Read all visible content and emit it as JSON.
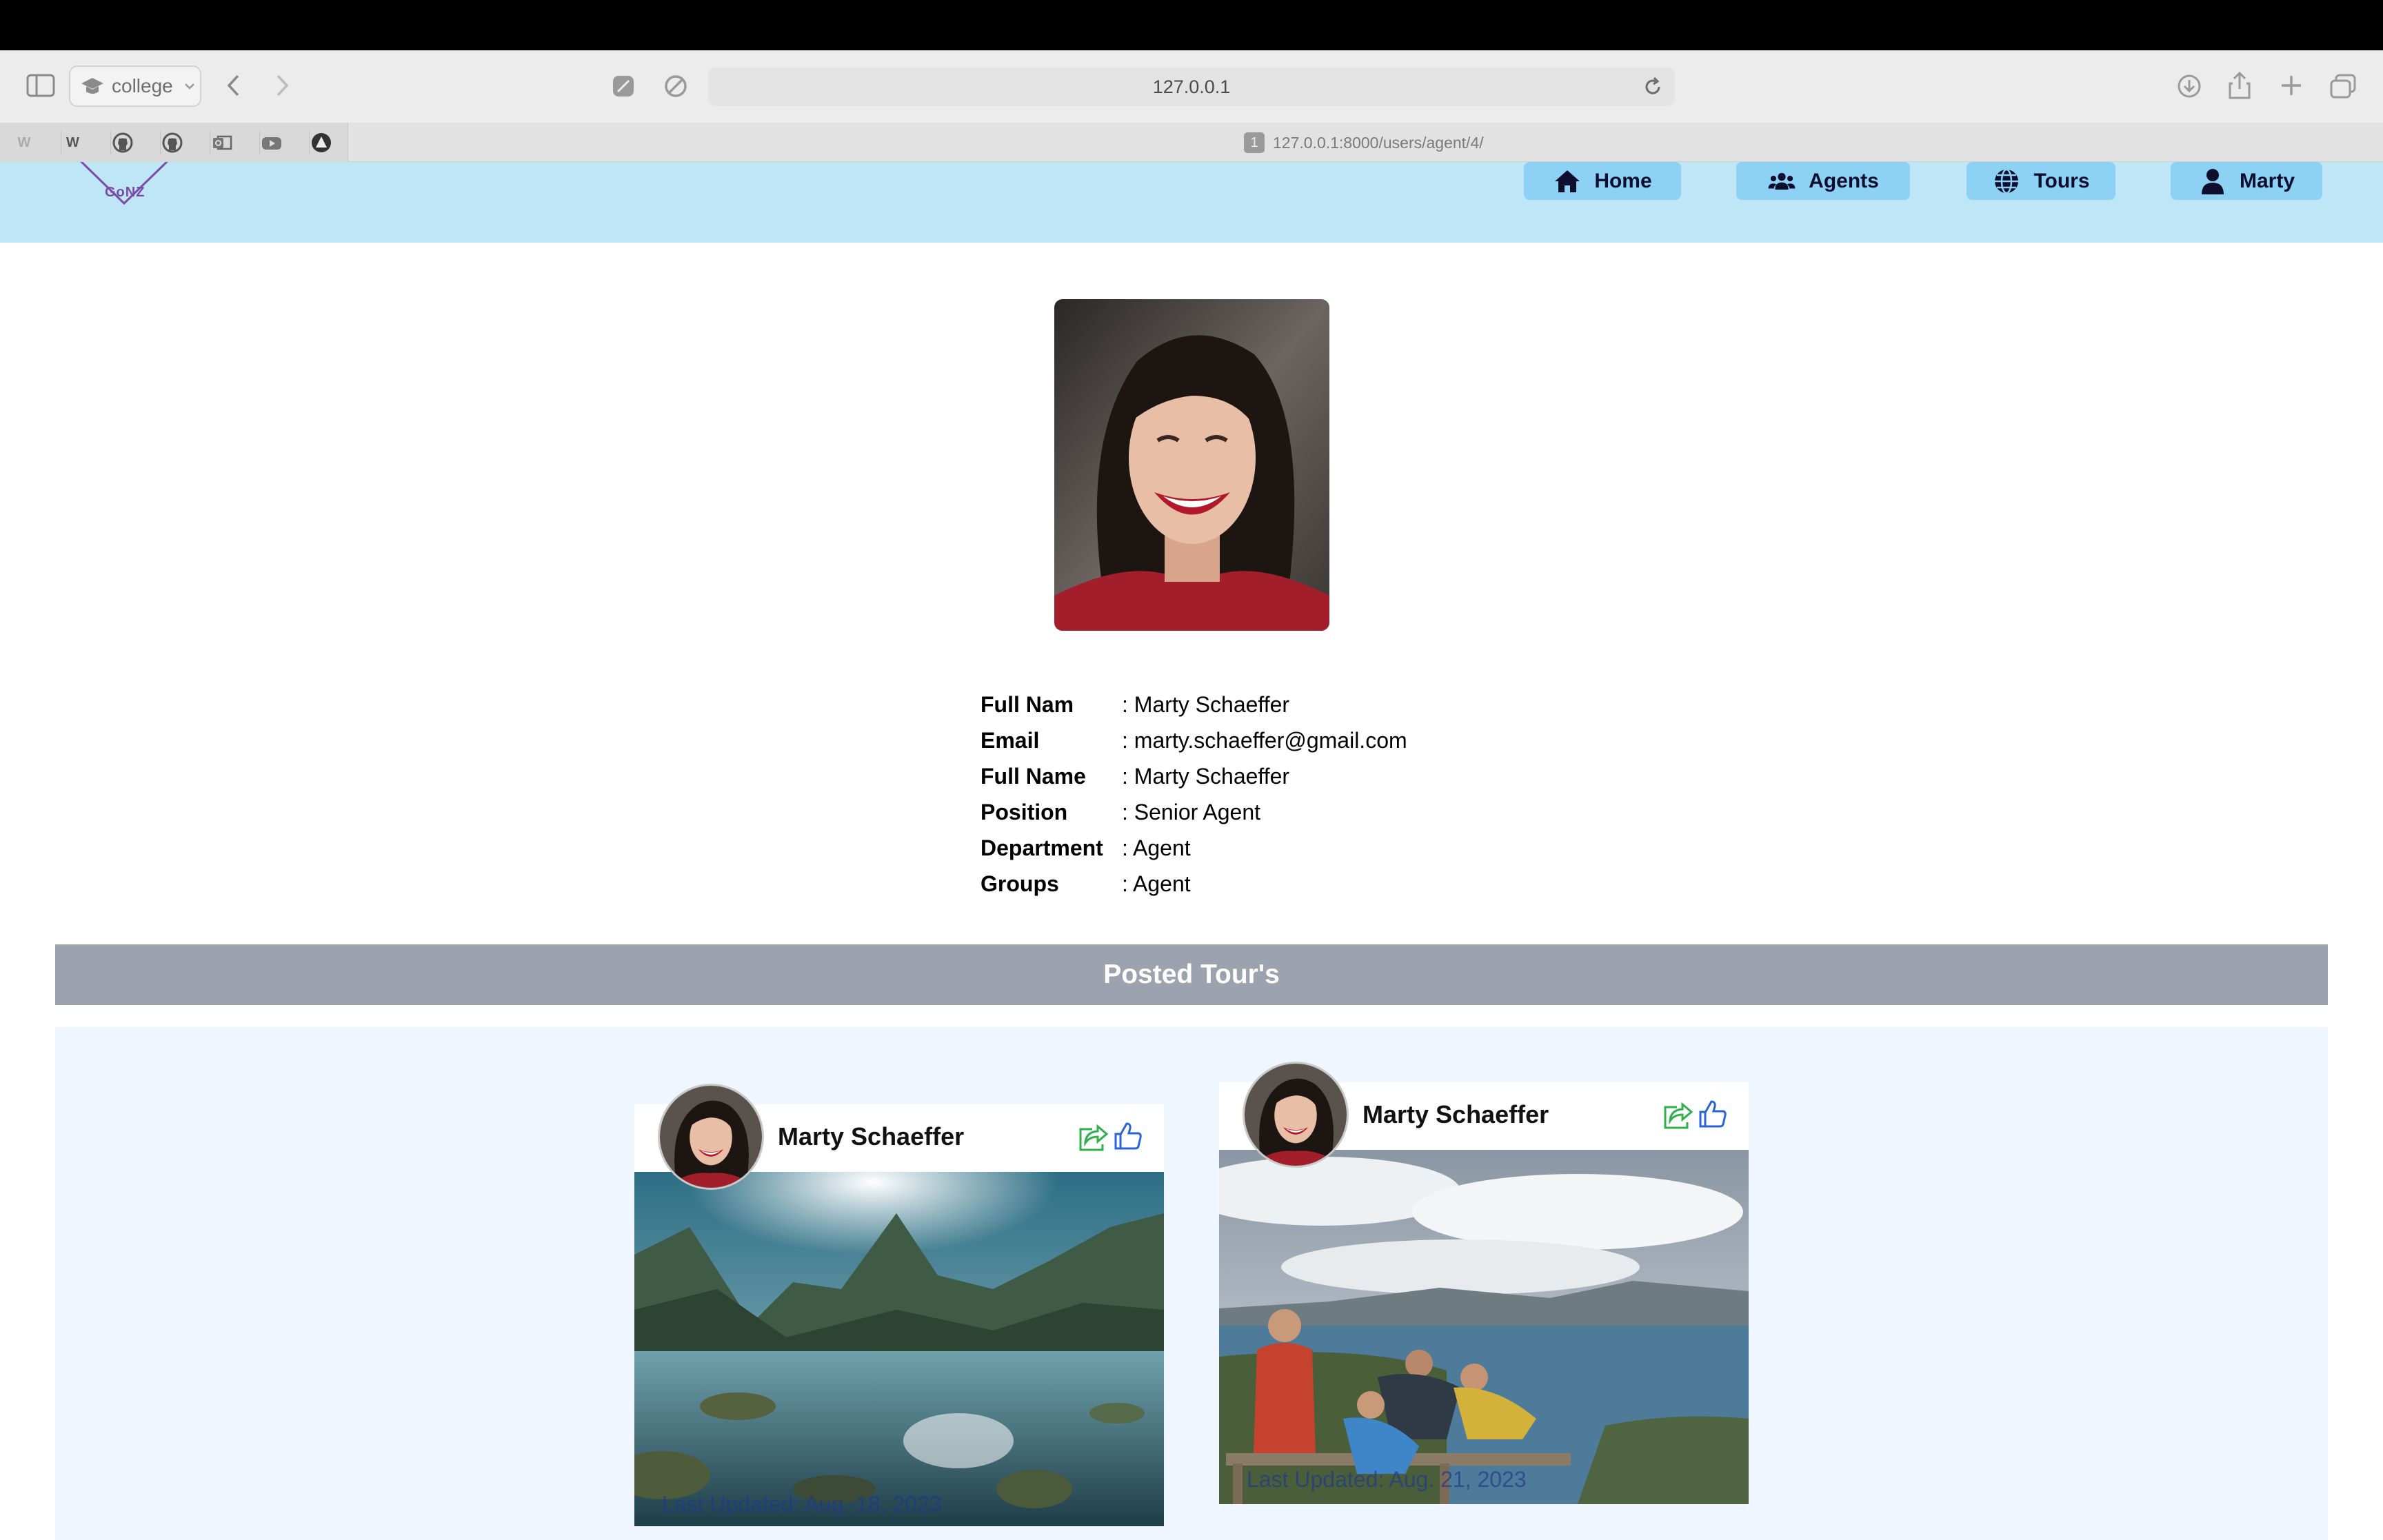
{
  "browser": {
    "profile": "college",
    "address": "127.0.0.1",
    "tab_number": "1",
    "tab_title": "127.0.0.1:8000/users/agent/4/"
  },
  "nav": {
    "logo_text": "GoNZ",
    "home": "Home",
    "agents": "Agents",
    "tours": "Tours",
    "user": "Marty"
  },
  "profile": {
    "rows": [
      {
        "label": "Full Nam",
        "value": ": Marty Schaeffer"
      },
      {
        "label": "Email",
        "value": ": marty.schaeffer@gmail.com"
      },
      {
        "label": "Full Name",
        "value": ": Marty Schaeffer"
      },
      {
        "label": "Position",
        "value": ": Senior Agent"
      },
      {
        "label": "Department",
        "value": ": Agent"
      },
      {
        "label": "Groups",
        "value": ": Agent"
      }
    ]
  },
  "posted": {
    "heading": "Posted Tour's",
    "tours": [
      {
        "author": "Marty Schaeffer",
        "updated": "Last Updated: Aug. 18, 2023"
      },
      {
        "author": "Marty Schaeffer",
        "updated": "Last Updated: Aug. 21, 2023"
      }
    ]
  },
  "colors": {
    "header_bg": "#bee6f7",
    "nav_button": "#8dd2f4",
    "banner": "#9ca3af",
    "tours_bg": "#eff6ff",
    "share": "#2fb04a",
    "like": "#2a63d6"
  }
}
